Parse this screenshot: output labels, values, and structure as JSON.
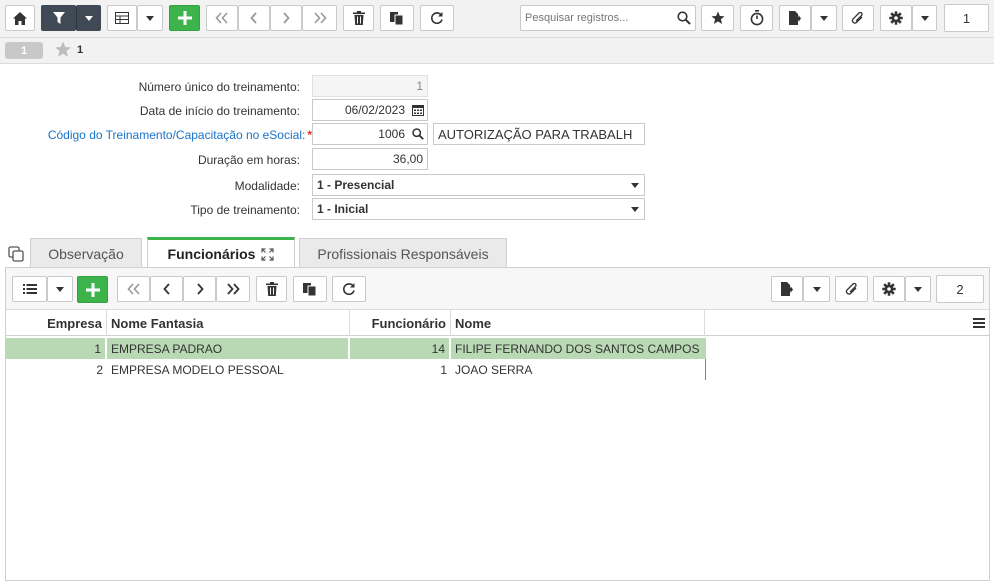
{
  "toolbar": {
    "search_placeholder": "Pesquisar registros...",
    "page_number": "1"
  },
  "record_strip": {
    "record_number": "1",
    "favorites_count": "1"
  },
  "form": {
    "fields": [
      {
        "label": "Número único do treinamento:",
        "value": "1"
      },
      {
        "label": "Data de início do treinamento:",
        "value": "06/02/2023"
      },
      {
        "label": "Código do Treinamento/Capacitação no eSocial:",
        "value": "1006",
        "description": "AUTORIZAÇÃO PARA TRABALH",
        "required_mark": "*"
      },
      {
        "label": "Duração em horas:",
        "value": "36,00"
      },
      {
        "label": "Modalidade:",
        "value": "1 - Presencial"
      },
      {
        "label": "Tipo de treinamento:",
        "value": "1 - Inicial"
      }
    ]
  },
  "tabs": [
    {
      "label": "Observação"
    },
    {
      "label": "Funcionários"
    },
    {
      "label": "Profissionais Responsáveis"
    }
  ],
  "detail": {
    "page_number": "2",
    "columns": [
      "Empresa",
      "Nome Fantasia",
      "Funcionário",
      "Nome"
    ],
    "rows": [
      {
        "empresa": "1",
        "nome_fantasia": "EMPRESA PADRAO",
        "funcionario": "14",
        "nome": "FILIPE FERNANDO DOS SANTOS CAMPOS"
      },
      {
        "empresa": "2",
        "nome_fantasia": "EMPRESA MODELO PESSOAL",
        "funcionario": "1",
        "nome": "JOAO SERRA"
      }
    ]
  },
  "colors": {
    "accent_green": "#3cb44b",
    "link_blue": "#1a73c8",
    "selected_row": "#b9d8b4",
    "dark_button": "#3f4a55"
  }
}
